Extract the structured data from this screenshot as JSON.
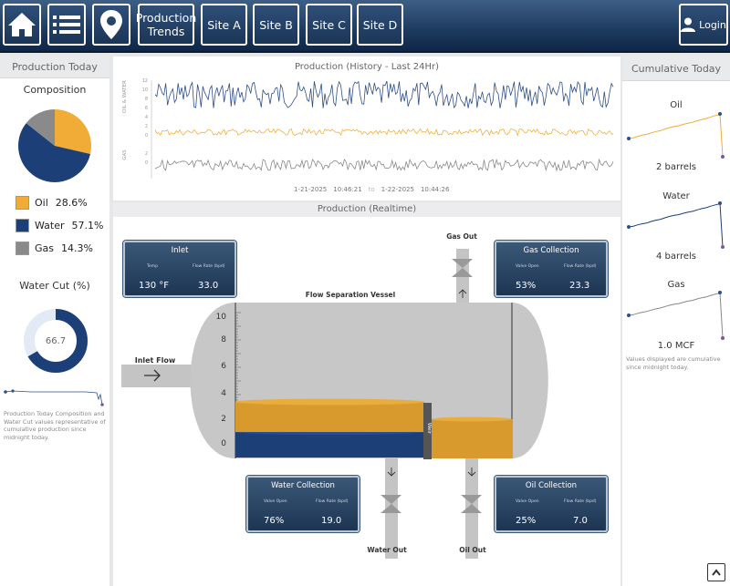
{
  "nav": {
    "production_trends": "Production Trends",
    "site_a": "Site A",
    "site_b": "Site B",
    "site_c": "Site C",
    "site_d": "Site D",
    "login": "Login"
  },
  "left": {
    "title": "Production Today",
    "composition_title": "Composition",
    "composition": [
      {
        "name": "Oil",
        "pct": "28.6%",
        "value": 28.6,
        "color": "#f1ac38"
      },
      {
        "name": "Water",
        "pct": "57.1%",
        "value": 57.1,
        "color": "#1d3f78"
      },
      {
        "name": "Gas",
        "pct": "14.3%",
        "value": 14.3,
        "color": "#8a8a8a"
      }
    ],
    "water_cut_title": "Water Cut (%)",
    "water_cut_value": "66.7",
    "water_cut_fraction": 0.667,
    "note": "Production Today Composition and Water Cut values representative of cumulative production since midnight today."
  },
  "history": {
    "title": "Production (History - Last 24Hr)",
    "y_label_top": "OIL & WATER",
    "y_label_bottom": "GAS",
    "y_ticks": [
      "12",
      "10",
      "8",
      "6",
      "4",
      "2",
      "0",
      "2",
      "0"
    ],
    "start_date": "1-21-2025",
    "start_time": "10:46:21",
    "to": "to",
    "end_date": "1-22-2025",
    "end_time": "10:44:26",
    "colors": {
      "water": "#2d4f86",
      "oil": "#f1b040",
      "gas": "#888888"
    }
  },
  "realtime": {
    "title": "Production (Realtime)",
    "vessel_title": "Flow Separation Vessel",
    "inlet_flow": "Inlet Flow",
    "gas_out": "Gas Out",
    "water_out": "Water Out",
    "oil_out": "Oil Out",
    "weir": "Weir",
    "scale": [
      "10",
      "8",
      "6",
      "4",
      "2",
      "0"
    ],
    "inlet": {
      "title": "Inlet",
      "label1": "Temp",
      "label2": "Flow Rate (bpd)",
      "value1": "130 °F",
      "value2": "33.0"
    },
    "gas_collection": {
      "title": "Gas Collection",
      "label1": "Valve Open",
      "label2": "Flow Rate (bpd)",
      "value1": "53%",
      "value2": "23.3"
    },
    "water_collection": {
      "title": "Water Collection",
      "label1": "Valve Open",
      "label2": "Flow Rate (bpd)",
      "value1": "76%",
      "value2": "19.0"
    },
    "oil_collection": {
      "title": "Oil Collection",
      "label1": "Valve Open",
      "label2": "Flow Rate (bpd)",
      "value1": "25%",
      "value2": "7.0"
    }
  },
  "cumulative": {
    "title": "Cumulative Today",
    "oil_title": "Oil",
    "oil_value": "2 barrels",
    "water_title": "Water",
    "water_value": "4 barrels",
    "gas_title": "Gas",
    "gas_value": "1.0 MCF",
    "note": "Values displayed are cumulative since midnight today."
  }
}
